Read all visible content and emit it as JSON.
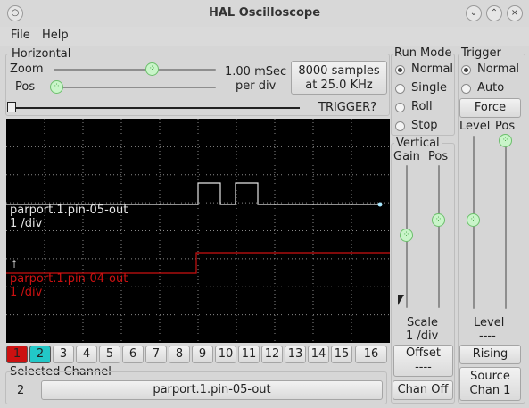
{
  "window": {
    "title": "HAL Oscilloscope",
    "buttons": [
      "circle-icon",
      "chevron-down-icon",
      "chevron-up-icon",
      "close-icon"
    ]
  },
  "menu": [
    "File",
    "Help"
  ],
  "horizontal": {
    "section_label": "Horizontal",
    "zoom_label": "Zoom",
    "pos_label": "Pos",
    "zoom_level": 0.6,
    "pos_level": 0.0,
    "timebase_line1": "1.00 mSec",
    "timebase_line2": "per div",
    "samples_line1": "8000 samples",
    "samples_line2": "at 25.0 KHz",
    "trigger_status": "TRIGGER?"
  },
  "run_mode": {
    "label": "Run Mode",
    "options": [
      "Normal",
      "Single",
      "Roll",
      "Stop"
    ],
    "selected": "Normal"
  },
  "trigger": {
    "label": "Trigger",
    "options": [
      "Normal",
      "Auto"
    ],
    "selected": "Normal",
    "force_label": "Force",
    "level_label": "Level",
    "pos_label": "Pos",
    "level_caption": "Level",
    "level_value": "----",
    "edge_label": "Rising",
    "source_line1": "Source",
    "source_line2": "Chan  1"
  },
  "vertical": {
    "label": "Vertical",
    "gain_label": "Gain",
    "pos_label": "Pos",
    "scale_label": "Scale",
    "scale_value": "1 /div",
    "offset_label": "Offset",
    "offset_value": "----",
    "chan_off_label": "Chan Off"
  },
  "scope": {
    "ch1_name": "parport.1.pin-05-out",
    "ch1_scale": "1 /div",
    "ch2_name": "parport.1.pin-04-out",
    "ch2_scale": "1 /div",
    "colors": {
      "ch1": "#e6e6e6",
      "ch2": "#cc1111",
      "grid": "#8a8a8a",
      "bg": "#000000"
    },
    "trigger_marker": "↑"
  },
  "channels": {
    "buttons": [
      "1",
      "2",
      "3",
      "4",
      "5",
      "6",
      "7",
      "8",
      "9",
      "10",
      "11",
      "12",
      "13",
      "14",
      "15",
      "16"
    ],
    "selected_label": "Selected Channel",
    "selected_number": "2",
    "selected_name": "parport.1.pin-05-out",
    "colors": {
      "1": "#cc1111",
      "2": "#22c8c8"
    }
  }
}
